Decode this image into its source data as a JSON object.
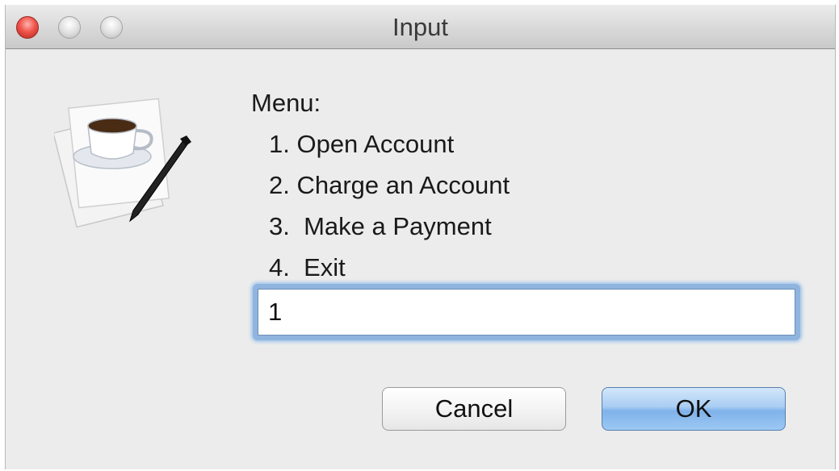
{
  "window": {
    "title": "Input"
  },
  "prompt": {
    "heading": "Menu:",
    "items": [
      "1. Open Account",
      "2. Charge an Account",
      "3.  Make a Payment",
      "4.  Exit"
    ]
  },
  "input": {
    "value": "1"
  },
  "buttons": {
    "cancel_label": "Cancel",
    "ok_label": "OK"
  },
  "icons": {
    "app_icon": "java-coffee-cup-document-icon"
  }
}
